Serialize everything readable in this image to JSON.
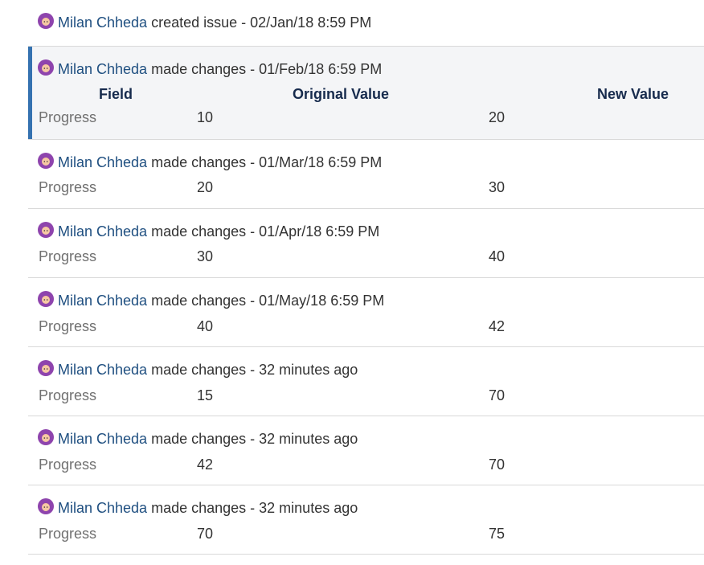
{
  "header_labels": {
    "field": "Field",
    "original": "Original Value",
    "new": "New Value"
  },
  "entries": [
    {
      "user": "Milan Chheda",
      "action": "created issue - 02/Jan/18 8:59 PM"
    },
    {
      "user": "Milan Chheda",
      "action": "made changes - 01/Feb/18 6:59 PM",
      "field": "Progress",
      "original": "10",
      "new": "20"
    },
    {
      "user": "Milan Chheda",
      "action": "made changes - 01/Mar/18 6:59 PM",
      "field": "Progress",
      "original": "20",
      "new": "30"
    },
    {
      "user": "Milan Chheda",
      "action": "made changes - 01/Apr/18 6:59 PM",
      "field": "Progress",
      "original": "30",
      "new": "40"
    },
    {
      "user": "Milan Chheda",
      "action": "made changes - 01/May/18 6:59 PM",
      "field": "Progress",
      "original": "40",
      "new": "42"
    },
    {
      "user": "Milan Chheda",
      "action": "made changes - 32 minutes ago",
      "field": "Progress",
      "original": "15",
      "new": "70"
    },
    {
      "user": "Milan Chheda",
      "action": "made changes - 32 minutes ago",
      "field": "Progress",
      "original": "42",
      "new": "70"
    },
    {
      "user": "Milan Chheda",
      "action": "made changes - 32 minutes ago",
      "field": "Progress",
      "original": "70",
      "new": "75"
    }
  ],
  "colors": {
    "link": "#205081",
    "selected_bar": "#3572b0",
    "selected_bg": "#f4f5f7",
    "avatar": "#8e44ad"
  },
  "icons": {
    "avatar": "user-avatar-icon"
  }
}
